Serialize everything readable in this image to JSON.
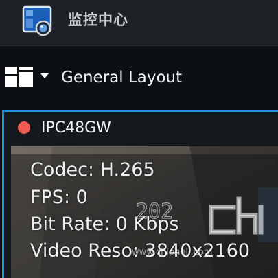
{
  "app": {
    "title": "监控中心",
    "logo_icon": "surveillance-camera-icon"
  },
  "toolbar": {
    "layout_icon": "layout-grid-icon",
    "dropdown_icon": "caret-down-icon",
    "layout_name": "General Layout"
  },
  "camera": {
    "name": "IPC48GW",
    "status_color": "#ef5a52",
    "highlight_color": "#1b8fe0",
    "info": {
      "codec_label": "Codec:",
      "codec_value": "H.265",
      "fps_label": "FPS:",
      "fps_value": "0",
      "bitrate_label": "Bit Rate:",
      "bitrate_value": "0 Kbps",
      "resolution_label": "Video Reso:",
      "resolution_value": "3840x2160"
    },
    "timestamp_fragment": "202"
  },
  "watermark": {
    "url": "www.chiphell.com"
  }
}
